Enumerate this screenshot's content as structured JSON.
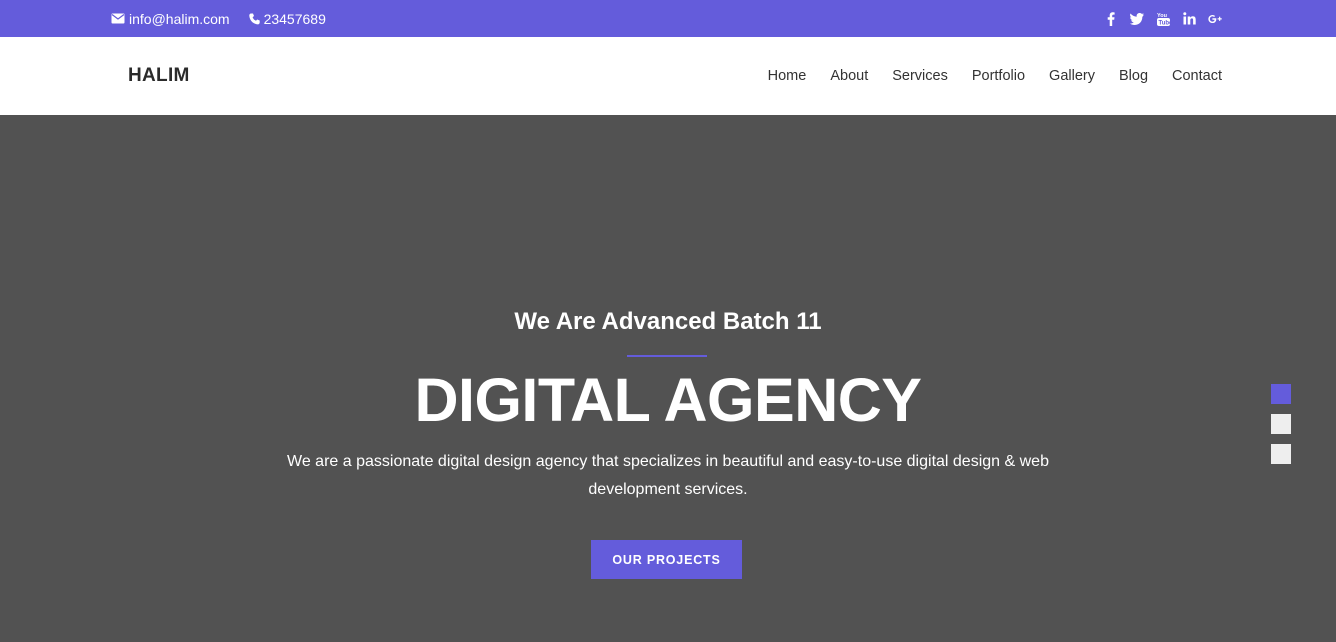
{
  "topbar": {
    "email": "info@halim.com",
    "phone": "23457689",
    "social": [
      "facebook-icon",
      "twitter-icon",
      "youtube-icon",
      "linkedin-icon",
      "google-plus-icon"
    ]
  },
  "nav": {
    "logo": "HALIM",
    "items": [
      "Home",
      "About",
      "Services",
      "Portfolio",
      "Gallery",
      "Blog",
      "Contact"
    ]
  },
  "hero": {
    "subtitle": "We Are Advanced Batch 11",
    "title": "DIGITAL AGENCY",
    "description": "We are a passionate digital design agency that specializes in beautiful and easy-to-use digital design & web development services.",
    "cta": "OUR PROJECTS",
    "slides": 3,
    "active_slide": 1
  },
  "colors": {
    "accent": "#645cdb",
    "hero_bg": "#525252"
  }
}
